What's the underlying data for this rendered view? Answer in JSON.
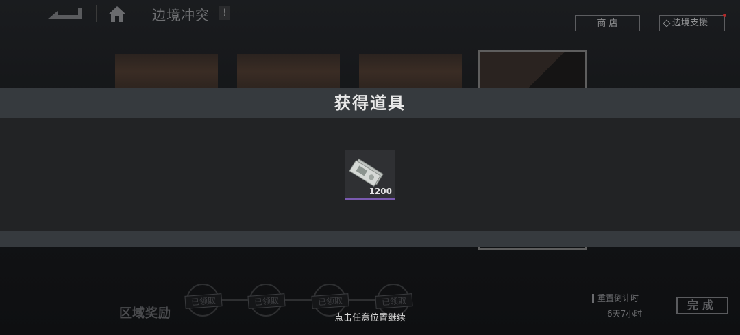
{
  "header": {
    "title": "边境冲突",
    "alert_mark": "!",
    "shop_label": "商 店",
    "support_label": "边境支援"
  },
  "popup": {
    "title": "获得道具",
    "items": [
      {
        "icon": "cash-bills-icon",
        "quantity": "1200",
        "rarity_color": "#7a5ab0"
      }
    ],
    "continue_hint": "点击任意位置继续"
  },
  "rewards": {
    "label": "区域奖励",
    "stamps": [
      "已领取",
      "已领取",
      "已领取",
      "已领取"
    ]
  },
  "reset": {
    "label": "重置倒计时",
    "time": "6天7小时"
  },
  "done_label": "完成",
  "colors": {
    "accent_red": "#b22a2a",
    "rarity_purple": "#7a5ab0"
  }
}
